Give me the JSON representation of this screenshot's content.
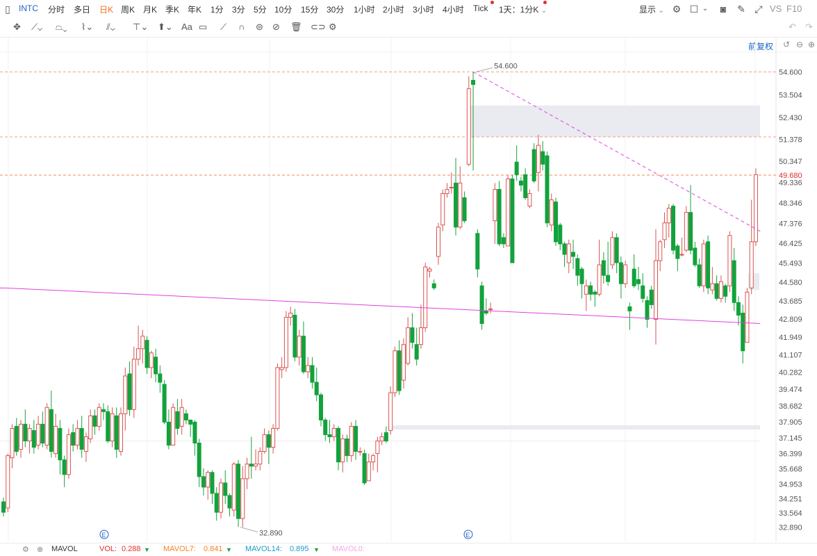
{
  "topbar": {
    "chart_toggle_icon": "panel-icon",
    "symbol": "INTC",
    "periods": [
      "分时",
      "多日",
      "日K",
      "周K",
      "月K",
      "季K",
      "年K",
      "1分",
      "3分",
      "5分",
      "10分",
      "15分",
      "30分",
      "1小时",
      "2小时",
      "3小时",
      "4小时",
      "Tick"
    ],
    "active_period": "日K",
    "custom_period": "1天：1分K",
    "display_label": "显示",
    "right_labels": [
      "VS",
      "F10"
    ]
  },
  "toolbar": {
    "restore_label": "前复权"
  },
  "bottom": {
    "indicator": "MAVOL",
    "vol": {
      "label": "VOL:",
      "value": "0.288",
      "color": "#e0312a"
    },
    "mavol7": {
      "label": "MAVOL7:",
      "value": "0.841",
      "color": "#f58220"
    },
    "mavol14": {
      "label": "MAVOL14:",
      "value": "0.895",
      "color": "#1a9bc9"
    },
    "mavol0": {
      "label": "MAVOL0:",
      "color": "#f2a6e6"
    }
  },
  "chart_data": {
    "type": "candlestick",
    "ylim": [
      32.3,
      55.0
    ],
    "y_ticks": [
      "54.600",
      "53.504",
      "52.430",
      "51.378",
      "50.347",
      "49.336",
      "48.346",
      "47.376",
      "46.425",
      "45.493",
      "44.580",
      "43.685",
      "42.809",
      "41.949",
      "41.107",
      "40.282",
      "39.474",
      "38.682",
      "37.905",
      "37.145",
      "36.399",
      "35.668",
      "34.953",
      "34.251",
      "33.564",
      "32.890"
    ],
    "last_price": "49.680",
    "high_label": "54.600",
    "low_label": "32.890",
    "up_color": "#d9534f",
    "down_color": "#12a23c",
    "candles": [
      [
        34.1,
        33.6,
        34.3,
        33.4
      ],
      [
        33.8,
        36.3,
        36.4,
        33.6
      ],
      [
        36.2,
        37.6,
        37.8,
        35.7
      ],
      [
        37.7,
        36.5,
        38.1,
        36.3
      ],
      [
        36.6,
        37.8,
        38.0,
        36.2
      ],
      [
        37.8,
        37.0,
        38.5,
        36.7
      ],
      [
        37.0,
        37.6,
        37.8,
        36.4
      ],
      [
        37.5,
        36.7,
        38.0,
        36.4
      ],
      [
        36.8,
        37.8,
        38.2,
        36.6
      ],
      [
        37.8,
        36.9,
        38.4,
        36.7
      ],
      [
        36.8,
        38.6,
        38.8,
        36.6
      ],
      [
        38.5,
        36.5,
        39.4,
        36.2
      ],
      [
        36.4,
        37.7,
        38.3,
        36.2
      ],
      [
        37.6,
        36.1,
        38.0,
        35.4
      ],
      [
        36.1,
        35.4,
        36.3,
        34.8
      ],
      [
        35.4,
        37.3,
        37.6,
        35.2
      ],
      [
        37.4,
        36.8,
        37.8,
        36.5
      ],
      [
        36.8,
        37.6,
        38.0,
        36.6
      ],
      [
        37.6,
        36.6,
        38.2,
        36.2
      ],
      [
        36.5,
        37.2,
        37.4,
        36.0
      ],
      [
        37.1,
        38.2,
        38.5,
        36.9
      ],
      [
        38.2,
        37.7,
        38.5,
        37.3
      ],
      [
        37.7,
        38.6,
        38.8,
        37.5
      ],
      [
        38.5,
        38.4,
        38.8,
        38.0
      ],
      [
        38.4,
        37.0,
        38.7,
        36.9
      ],
      [
        37.0,
        38.3,
        38.6,
        36.7
      ],
      [
        38.2,
        36.6,
        38.6,
        36.2
      ],
      [
        36.5,
        38.3,
        38.6,
        36.3
      ],
      [
        38.3,
        40.1,
        40.5,
        37.5
      ],
      [
        40.2,
        38.5,
        40.8,
        38.2
      ],
      [
        38.5,
        40.9,
        41.5,
        38.1
      ],
      [
        40.9,
        41.4,
        42.5,
        40.6
      ],
      [
        41.4,
        42.0,
        42.3,
        40.7
      ],
      [
        41.8,
        40.5,
        42.0,
        40.2
      ],
      [
        40.5,
        41.2,
        41.3,
        40.0
      ],
      [
        41.0,
        40.2,
        41.4,
        39.8
      ],
      [
        40.2,
        39.8,
        40.6,
        39.3
      ],
      [
        39.7,
        37.9,
        39.9,
        37.8
      ],
      [
        37.9,
        36.8,
        38.5,
        36.6
      ],
      [
        36.8,
        38.6,
        38.8,
        36.8
      ],
      [
        38.4,
        37.6,
        39.0,
        37.3
      ],
      [
        37.7,
        38.6,
        39.0,
        37.3
      ],
      [
        38.3,
        38.0,
        38.5,
        37.8
      ],
      [
        38.0,
        37.8,
        38.0,
        37.2
      ],
      [
        37.9,
        36.9,
        38.0,
        36.3
      ],
      [
        36.9,
        35.3,
        37.1,
        34.8
      ],
      [
        35.3,
        34.8,
        35.7,
        34.4
      ],
      [
        34.8,
        35.5,
        35.6,
        34.2
      ],
      [
        35.5,
        34.5,
        35.6,
        34.0
      ],
      [
        34.5,
        33.6,
        34.8,
        33.2
      ],
      [
        33.6,
        35.0,
        35.2,
        33.3
      ],
      [
        35.0,
        34.4,
        35.6,
        34.0
      ],
      [
        34.4,
        33.8,
        34.5,
        33.4
      ],
      [
        33.7,
        35.9,
        36.0,
        33.4
      ],
      [
        35.9,
        33.3,
        36.1,
        32.9
      ],
      [
        33.3,
        35.2,
        35.8,
        32.9
      ],
      [
        35.2,
        35.9,
        36.2,
        34.7
      ],
      [
        35.9,
        35.8,
        37.2,
        35.2
      ],
      [
        35.8,
        35.9,
        36.6,
        35.6
      ],
      [
        35.9,
        36.5,
        36.7,
        35.6
      ],
      [
        36.5,
        37.3,
        37.6,
        36.4
      ],
      [
        37.3,
        36.7,
        37.5,
        35.9
      ],
      [
        36.7,
        37.6,
        37.8,
        36.4
      ],
      [
        37.6,
        40.5,
        40.7,
        37.5
      ],
      [
        40.4,
        40.5,
        41.0,
        40.0
      ],
      [
        40.5,
        42.9,
        43.2,
        40.3
      ],
      [
        42.9,
        43.1,
        43.4,
        42.5
      ],
      [
        43.0,
        41.0,
        43.3,
        40.8
      ],
      [
        41.0,
        42.0,
        42.3,
        40.6
      ],
      [
        42.0,
        40.3,
        42.7,
        40.2
      ],
      [
        40.3,
        40.6,
        41.0,
        40.0
      ],
      [
        40.6,
        39.8,
        41.0,
        39.5
      ],
      [
        39.8,
        39.2,
        40.5,
        38.9
      ],
      [
        39.2,
        38.0,
        39.3,
        37.7
      ],
      [
        38.0,
        37.3,
        38.1,
        37.0
      ],
      [
        37.3,
        37.2,
        38.0,
        36.9
      ],
      [
        37.2,
        37.6,
        37.8,
        37.0
      ],
      [
        37.6,
        36.0,
        37.7,
        35.6
      ],
      [
        36.0,
        37.1,
        37.3,
        35.5
      ],
      [
        37.1,
        36.3,
        37.3,
        36.0
      ],
      [
        36.3,
        37.7,
        37.9,
        36.0
      ],
      [
        37.7,
        36.5,
        38.0,
        36.1
      ],
      [
        36.5,
        36.5,
        36.7,
        36.3
      ],
      [
        36.4,
        35.0,
        36.6,
        34.9
      ],
      [
        35.1,
        36.0,
        36.4,
        35.1
      ],
      [
        36.0,
        36.3,
        36.4,
        35.6
      ],
      [
        36.4,
        37.0,
        37.2,
        35.5
      ],
      [
        37.0,
        37.2,
        37.4,
        36.8
      ],
      [
        37.4,
        37.0,
        37.7,
        36.9
      ],
      [
        37.5,
        39.3,
        39.6,
        37.3
      ],
      [
        39.3,
        41.3,
        41.5,
        39.1
      ],
      [
        41.3,
        39.4,
        41.8,
        39.2
      ],
      [
        39.9,
        41.6,
        41.9,
        39.5
      ],
      [
        40.7,
        42.4,
        42.9,
        40.6
      ],
      [
        42.4,
        41.7,
        43.1,
        41.4
      ],
      [
        41.6,
        40.9,
        42.4,
        40.6
      ],
      [
        41.6,
        42.4,
        43.5,
        41.4
      ],
      [
        42.4,
        45.3,
        45.5,
        42.2
      ],
      [
        45.1,
        45.2,
        45.3,
        44.8
      ],
      [
        44.5,
        44.3,
        44.7,
        44.2
      ],
      [
        45.8,
        47.2,
        47.4,
        45.4
      ],
      [
        47.3,
        48.8,
        49.0,
        47.0
      ],
      [
        48.8,
        49.0,
        49.3,
        48.6
      ],
      [
        49.1,
        49.1,
        49.8,
        48.8
      ],
      [
        49.3,
        47.2,
        50.5,
        46.8
      ],
      [
        47.2,
        49.3,
        50.1,
        47.1
      ],
      [
        48.6,
        47.5,
        48.9,
        47.4
      ],
      [
        50.2,
        53.8,
        54.4,
        50.1
      ],
      [
        54.2,
        54.0,
        54.6,
        49.9
      ],
      [
        46.9,
        45.2,
        47.1,
        44.8
      ],
      [
        44.4,
        42.6,
        44.6,
        42.3
      ],
      [
        43.2,
        43.1,
        43.8,
        43.0
      ],
      [
        43.3,
        43.3,
        43.6,
        43.1
      ],
      [
        47.5,
        49.0,
        49.3,
        46.4
      ],
      [
        49.0,
        46.4,
        49.4,
        46.3
      ],
      [
        46.7,
        46.4,
        46.9,
        46.2
      ],
      [
        46.3,
        49.5,
        49.7,
        46.3
      ],
      [
        49.5,
        45.5,
        49.7,
        45.5
      ],
      [
        50.3,
        49.7,
        51.1,
        49.4
      ],
      [
        49.4,
        49.2,
        49.6,
        48.9
      ],
      [
        49.7,
        48.6,
        50.0,
        48.5
      ],
      [
        48.2,
        48.8,
        49.0,
        48.1
      ],
      [
        50.9,
        49.4,
        51.2,
        49.3
      ],
      [
        49.8,
        51.1,
        51.6,
        48.9
      ],
      [
        50.8,
        50.2,
        51.3,
        49.9
      ],
      [
        50.6,
        47.4,
        50.8,
        47.2
      ],
      [
        47.3,
        48.5,
        48.8,
        47.0
      ],
      [
        48.4,
        46.5,
        48.6,
        46.3
      ],
      [
        47.3,
        46.4,
        47.4,
        46.1
      ],
      [
        46.4,
        45.9,
        46.5,
        45.3
      ],
      [
        45.5,
        46.4,
        46.6,
        45.0
      ],
      [
        46.0,
        45.8,
        46.6,
        45.2
      ],
      [
        45.7,
        44.9,
        45.9,
        44.4
      ],
      [
        45.2,
        44.5,
        45.3,
        43.8
      ],
      [
        44.0,
        44.4,
        44.7,
        43.2
      ],
      [
        44.4,
        44.0,
        44.6,
        43.7
      ],
      [
        44.1,
        44.0,
        44.2,
        43.4
      ],
      [
        44.0,
        45.4,
        46.6,
        43.9
      ],
      [
        45.6,
        44.9,
        46.0,
        44.5
      ],
      [
        44.9,
        44.6,
        46.5,
        44.4
      ],
      [
        45.4,
        46.7,
        47.0,
        45.2
      ],
      [
        46.7,
        45.5,
        46.9,
        45.0
      ],
      [
        45.5,
        44.5,
        45.8,
        43.8
      ],
      [
        44.5,
        45.4,
        45.6,
        44.3
      ],
      [
        43.4,
        43.2,
        43.6,
        42.3
      ],
      [
        45.2,
        44.4,
        45.9,
        44.3
      ],
      [
        44.7,
        44.5,
        45.3,
        44.2
      ],
      [
        44.4,
        43.8,
        45.0,
        43.6
      ],
      [
        43.7,
        42.8,
        43.9,
        42.4
      ],
      [
        44.2,
        43.5,
        44.4,
        43.3
      ],
      [
        42.8,
        45.6,
        47.1,
        41.6
      ],
      [
        45.6,
        46.5,
        46.6,
        45.1
      ],
      [
        46.6,
        47.4,
        47.9,
        46.2
      ],
      [
        47.4,
        48.1,
        48.3,
        46.7
      ],
      [
        48.2,
        46.1,
        48.3,
        45.9
      ],
      [
        46.3,
        45.7,
        46.4,
        45.1
      ],
      [
        45.9,
        45.9,
        46.7,
        45.8
      ],
      [
        46.1,
        47.9,
        48.2,
        46.0
      ],
      [
        47.9,
        46.1,
        49.2,
        45.9
      ],
      [
        46.2,
        45.4,
        46.5,
        45.3
      ],
      [
        45.4,
        44.4,
        45.7,
        44.3
      ],
      [
        44.4,
        46.4,
        46.6,
        44.1
      ],
      [
        46.5,
        44.3,
        46.8,
        44.0
      ],
      [
        44.2,
        44.5,
        45.3,
        44.0
      ],
      [
        44.5,
        43.8,
        44.9,
        43.7
      ],
      [
        43.8,
        44.6,
        44.9,
        43.6
      ],
      [
        44.4,
        43.9,
        44.5,
        43.6
      ],
      [
        44.4,
        46.8,
        47.0,
        44.1
      ],
      [
        45.6,
        43.6,
        46.2,
        43.2
      ],
      [
        43.6,
        43.0,
        43.9,
        42.5
      ],
      [
        43.1,
        41.3,
        43.5,
        40.7
      ],
      [
        41.7,
        44.1,
        44.3,
        41.9
      ],
      [
        44.3,
        46.5,
        48.5,
        44.0
      ],
      [
        46.5,
        49.7,
        50.0,
        46.3
      ]
    ],
    "lines": [
      {
        "name": "",
        "kind": "trend",
        "color": "#e040e0",
        "dash": false,
        "from": [
          0,
          44.3
        ],
        "to": [
          174,
          42.6
        ]
      },
      {
        "name": "",
        "kind": "trend",
        "color": "#e040e0",
        "dash": true,
        "from": [
          108,
          54.6
        ],
        "to": [
          174,
          47.0
        ]
      }
    ]
  }
}
